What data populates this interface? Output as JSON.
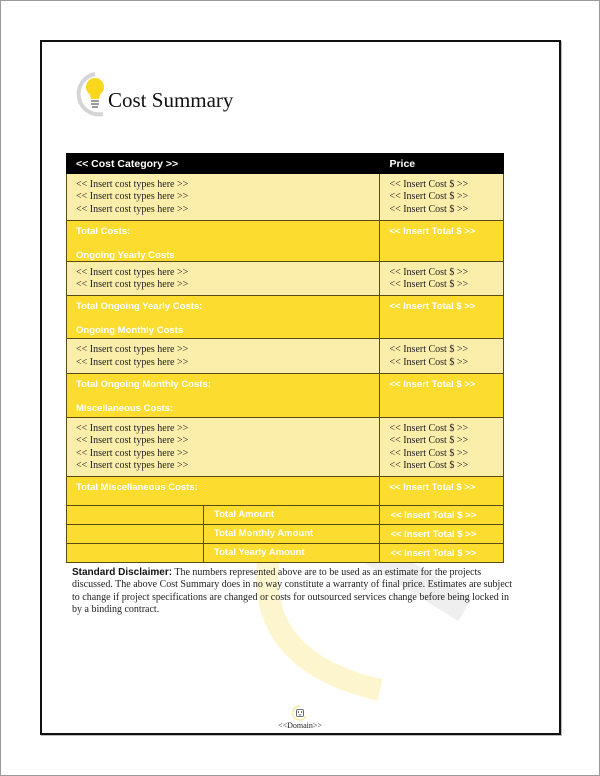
{
  "document": {
    "title": "Cost Summary",
    "title_icon": "lightbulb-icon"
  },
  "table": {
    "header": {
      "category": "<< Cost Category >>",
      "price": "Price"
    },
    "sections": [
      {
        "items": [
          {
            "type": "<< Insert cost types here >>",
            "cost": "<< Insert Cost $ >>"
          },
          {
            "type": "<< Insert cost types here >>",
            "cost": "<< Insert Cost $ >>"
          },
          {
            "type": "<< Insert cost types here >>",
            "cost": "<< Insert Cost $ >>"
          }
        ],
        "total_label": "Total Costs:",
        "total_value": "<< Insert Total $ >>",
        "next_heading": "Ongoing Yearly Costs"
      },
      {
        "items": [
          {
            "type": "<< Insert cost types here >>",
            "cost": "<< Insert Cost $ >>"
          },
          {
            "type": "<< Insert cost types here >>",
            "cost": "<< Insert Cost $ >>"
          }
        ],
        "total_label": "Total Ongoing Yearly Costs:",
        "total_value": "<< Insert Total $ >>",
        "next_heading": "Ongoing Monthly Costs"
      },
      {
        "items": [
          {
            "type": "<< Insert cost types here >>",
            "cost": "<< Insert Cost $ >>"
          },
          {
            "type": "<< Insert cost types here >>",
            "cost": "<< Insert Cost $ >>"
          }
        ],
        "total_label": "Total Ongoing Monthly Costs:",
        "total_value": "<< Insert Total $ >>",
        "next_heading": "Miscellaneous Costs:"
      },
      {
        "items": [
          {
            "type": "<< Insert cost types here >>",
            "cost": "<< Insert Cost $ >>"
          },
          {
            "type": "<< Insert cost types here >>",
            "cost": "<< Insert Cost $ >>"
          },
          {
            "type": "<< Insert cost types here >>",
            "cost": "<< Insert Cost $ >>"
          },
          {
            "type": "<< Insert cost types here >>",
            "cost": "<< Insert Cost $ >>"
          }
        ],
        "total_label": "Total Miscellaneous Costs:",
        "total_value": "<< Insert Total $ >>",
        "next_heading": ""
      }
    ],
    "summary": [
      {
        "label": "Total Amount",
        "value": "<< Insert Total $ >>"
      },
      {
        "label": "Total Monthly Amount",
        "value": "<< Insert Total $ >>"
      },
      {
        "label": "Total Yearly Amount",
        "value": "<< Insert Total $ >>"
      }
    ]
  },
  "disclaimer": {
    "lead": "Standard Disclaimer:",
    "text": " The numbers represented above are to be used as an estimate for the projects discussed. The above Cost Summary does in no way constitute a warranty of final price.  Estimates are subject to change if project specifications are changed or costs for outsourced services change before being locked in by a binding contract."
  },
  "footer": {
    "icon": "outlet-icon",
    "text": "<<Domain>>"
  },
  "colors": {
    "header_bg": "#000000",
    "light_row": "#fbedaa",
    "dark_row": "#fcdc2f",
    "accent_yellow": "#f9d71c"
  }
}
